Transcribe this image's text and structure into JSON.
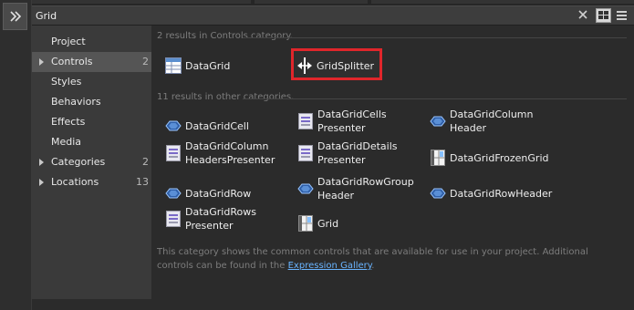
{
  "search": {
    "value": "Grid"
  },
  "sidebar": {
    "items": [
      {
        "label": "Project",
        "count": "",
        "arrow": false,
        "selected": false
      },
      {
        "label": "Controls",
        "count": "2",
        "arrow": true,
        "selected": true
      },
      {
        "label": "Styles",
        "count": "",
        "arrow": false,
        "selected": false
      },
      {
        "label": "Behaviors",
        "count": "",
        "arrow": false,
        "selected": false
      },
      {
        "label": "Effects",
        "count": "",
        "arrow": false,
        "selected": false
      },
      {
        "label": "Media",
        "count": "",
        "arrow": false,
        "selected": false
      },
      {
        "label": "Categories",
        "count": "2",
        "arrow": true,
        "selected": false
      },
      {
        "label": "Locations",
        "count": "13",
        "arrow": true,
        "selected": false
      }
    ]
  },
  "results": {
    "category_header": "2 results in Controls category.",
    "category_items": [
      {
        "label": "DataGrid",
        "icon": "datagrid-icon"
      },
      {
        "label": "GridSplitter",
        "icon": "gridsplitter-icon"
      }
    ],
    "other_header": "11 results in other categories.",
    "other_items": [
      {
        "label": "DataGridCell",
        "icon": "diamond-icon"
      },
      {
        "label": "DataGridCells\nPresenter",
        "icon": "presenter-icon"
      },
      {
        "label": "DataGridColumn\nHeader",
        "icon": "diamond-icon"
      },
      {
        "label": "DataGridColumn\nHeadersPresenter",
        "icon": "presenter-icon"
      },
      {
        "label": "DataGridDetails\nPresenter",
        "icon": "presenter-icon"
      },
      {
        "label": "DataGridFrozenGrid",
        "icon": "grid-icon"
      },
      {
        "label": "DataGridRow",
        "icon": "diamond-icon"
      },
      {
        "label": "DataGridRowGroup\nHeader",
        "icon": "diamond-icon"
      },
      {
        "label": "DataGridRowHeader",
        "icon": "diamond-icon"
      },
      {
        "label": "DataGridRows\nPresenter",
        "icon": "presenter-icon"
      },
      {
        "label": "Grid",
        "icon": "grid-icon"
      }
    ]
  },
  "footer": {
    "text": "This category shows the common controls that are available for use in your project. Additional controls can be found in the ",
    "link": "Expression Gallery",
    "suffix": "."
  }
}
